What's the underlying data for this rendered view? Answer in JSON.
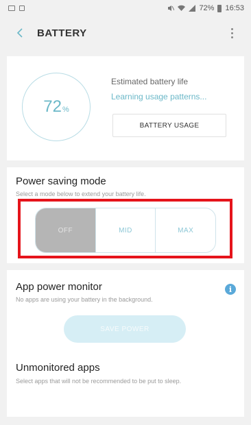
{
  "status_bar": {
    "battery_percent": "72%",
    "time": "16:53",
    "icons": [
      "gallery-icon",
      "sim-icon",
      "mute-icon",
      "wifi-icon",
      "signal-icon",
      "battery-icon"
    ]
  },
  "header": {
    "title": "BATTERY"
  },
  "battery_card": {
    "level": "72",
    "level_unit": "%",
    "estimated_label": "Estimated battery life",
    "estimated_value": "Learning usage patterns...",
    "usage_button": "BATTERY USAGE"
  },
  "power_saving": {
    "title": "Power saving mode",
    "subtitle": "Select a mode below to extend your battery life.",
    "modes": [
      "OFF",
      "MID",
      "MAX"
    ],
    "selected": "OFF"
  },
  "app_power_monitor": {
    "title": "App power monitor",
    "subtitle": "No apps are using your battery in the background.",
    "save_button": "SAVE POWER"
  },
  "unmonitored": {
    "title": "Unmonitored apps",
    "subtitle": "Select apps that will not be recommended to be put to sleep."
  },
  "colors": {
    "accent": "#6bb8c8",
    "highlight_border": "#e5141b",
    "selected_segment": "#b5b5b5",
    "info": "#5aa9d9"
  }
}
